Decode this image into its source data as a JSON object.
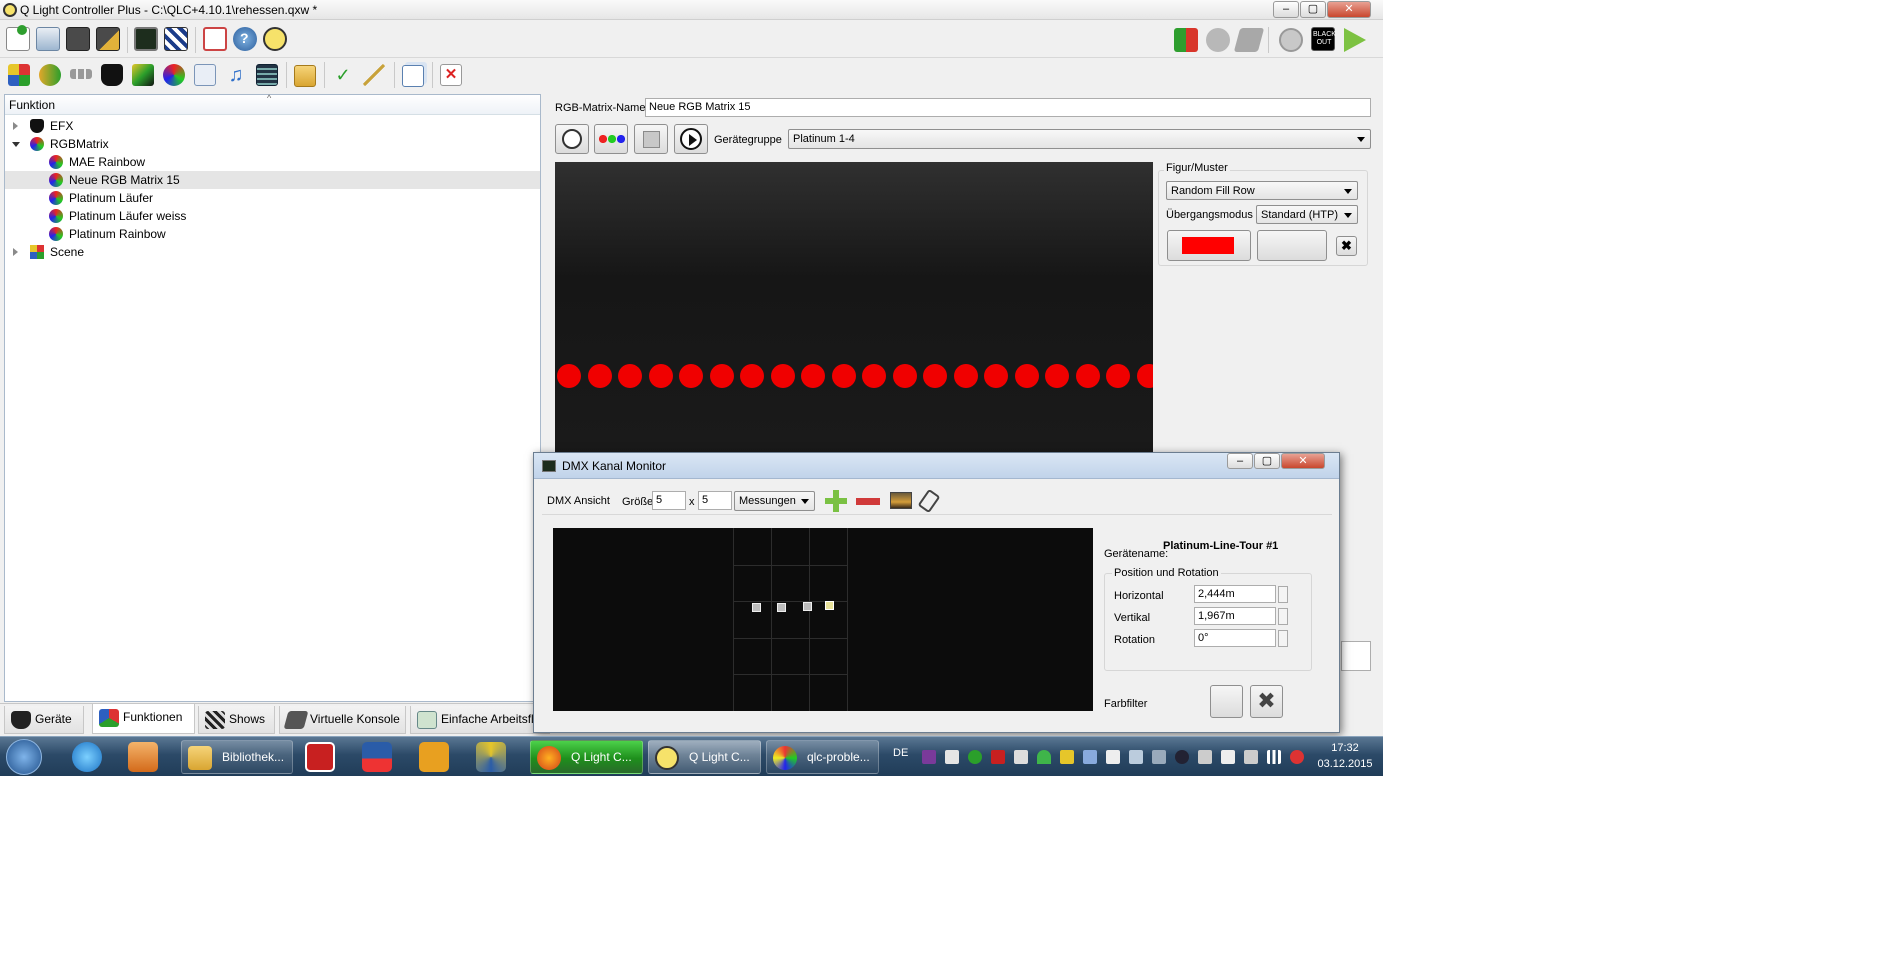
{
  "window": {
    "title": "Q Light Controller Plus - C:\\QLC+4.10.1\\rehessen.qxw *",
    "min": "–",
    "max": "▢",
    "close": "✕"
  },
  "toolbar": {
    "blackout_label": "BLACK OUT",
    "icons_main": [
      "new-workspace-icon",
      "open-workspace-icon",
      "save-icon",
      "save-as-icon",
      "dmx-monitor-icon",
      "address-tool-icon",
      "fullscreen-icon",
      "help-icon",
      "about-icon"
    ],
    "icons_right": [
      "fixture-remap-icon",
      "dmx-input-icon",
      "dmx-output-icon",
      "stop-all-icon",
      "blackout-icon",
      "operate-mode-icon"
    ],
    "icons_functions": [
      "new-scene-icon",
      "new-chaser-icon",
      "new-sequence-icon",
      "new-efx-icon",
      "new-collection-icon",
      "new-rgbmatrix-icon",
      "new-script-icon",
      "new-audio-icon",
      "new-video-icon",
      "new-folder-icon",
      "function-wizard-icon",
      "autostart-icon",
      "clone-icon",
      "delete-icon"
    ]
  },
  "function_tree": {
    "header": "Funktion",
    "items": [
      {
        "label": "EFX",
        "level": 0,
        "icon": "efx-icon",
        "expanded": false
      },
      {
        "label": "RGBMatrix",
        "level": 0,
        "icon": "rgbmatrix-icon",
        "expanded": true
      },
      {
        "label": "MAE Rainbow",
        "level": 1,
        "icon": "rgbmatrix-icon"
      },
      {
        "label": "Neue RGB Matrix 15",
        "level": 1,
        "icon": "rgbmatrix-icon",
        "selected": true
      },
      {
        "label": "Platinum Läufer",
        "level": 1,
        "icon": "rgbmatrix-icon"
      },
      {
        "label": "Platinum Läufer weiss",
        "level": 1,
        "icon": "rgbmatrix-icon"
      },
      {
        "label": "Platinum Rainbow",
        "level": 1,
        "icon": "rgbmatrix-icon"
      },
      {
        "label": "Scene",
        "level": 0,
        "icon": "scene-icon",
        "expanded": false
      }
    ]
  },
  "tabs": [
    {
      "label": "Geräte",
      "icon": "fixtures-icon"
    },
    {
      "label": "Funktionen",
      "icon": "functions-icon",
      "active": true
    },
    {
      "label": "Shows",
      "icon": "shows-icon"
    },
    {
      "label": "Virtuelle Konsole",
      "icon": "virtual-console-icon"
    },
    {
      "label": "Einfache Arbeitsfl",
      "icon": "simple-desk-icon"
    }
  ],
  "rgb_editor": {
    "name_label": "RGB-Matrix-Name",
    "name_value": "Neue RGB Matrix 15",
    "group_label": "Gerätegruppe",
    "group_value": "Platinum 1-4",
    "pattern_group": "Figur/Muster",
    "pattern_value": "Random Fill Row",
    "blend_label": "Übergangsmodus",
    "blend_value": "Standard (HTP)",
    "start_color": "#ff0000",
    "preview_dot_color": "#f00000",
    "preview_dot_count": 20
  },
  "dmx_monitor": {
    "title": "DMX Kanal Monitor",
    "view_label": "DMX Ansicht",
    "size_label": "Größe",
    "size_w": "5",
    "size_x": "x",
    "size_h": "5",
    "mode_value": "Messungen",
    "device_name_label": "Gerätename:",
    "device_name": "Platinum-Line-Tour #1",
    "pos_group": "Position und Rotation",
    "horizontal_label": "Horizontal",
    "horizontal_value": "2,444m",
    "vertical_label": "Vertikal",
    "vertical_value": "1,967m",
    "rotation_label": "Rotation",
    "rotation_value": "0°",
    "gel_label": "Farbfilter"
  },
  "taskbar": {
    "tasks": [
      {
        "label": "Bibliothek...",
        "icon": "explorer-folder-icon"
      },
      {
        "label": "Q Light C...",
        "icon": "firefox-icon"
      },
      {
        "label": "Q Light C...",
        "icon": "qlc-icon"
      },
      {
        "label": "qlc-proble...",
        "icon": "paint-icon"
      }
    ],
    "lang": "DE",
    "time": "17:32",
    "date": "03.12.2015"
  }
}
